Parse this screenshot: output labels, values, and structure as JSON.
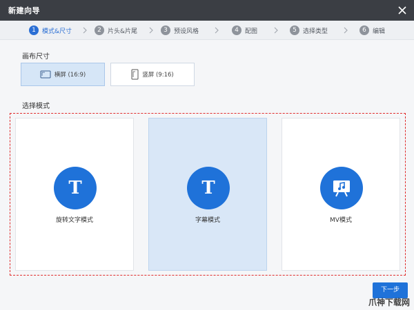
{
  "window": {
    "title": "新建向导"
  },
  "steps": [
    {
      "num": "1",
      "label": "模式&尺寸"
    },
    {
      "num": "2",
      "label": "片头&片尾"
    },
    {
      "num": "3",
      "label": "预设风格"
    },
    {
      "num": "4",
      "label": "配图"
    },
    {
      "num": "5",
      "label": "选择类型"
    },
    {
      "num": "6",
      "label": "编辑"
    }
  ],
  "canvas_size": {
    "label": "画布尺寸",
    "options": [
      {
        "label": "横屏 (16:9)",
        "icon": "landscape-screen-icon",
        "selected": true
      },
      {
        "label": "竖屏 (9:16)",
        "icon": "portrait-screen-icon",
        "selected": false
      }
    ]
  },
  "mode": {
    "label": "选择模式",
    "options": [
      {
        "label": "旋转文字模式",
        "icon": "text-t-icon",
        "glyph": "T",
        "selected": false
      },
      {
        "label": "字幕模式",
        "icon": "text-t-icon",
        "glyph": "T",
        "selected": true
      },
      {
        "label": "MV模式",
        "icon": "music-board-icon",
        "selected": false
      }
    ]
  },
  "footer": {
    "next_label": "下一步"
  },
  "watermark": "爪神下载网",
  "colors": {
    "accent": "#1f72d9",
    "titlebar": "#3b3e44",
    "selection_border": "#e02a2a"
  }
}
